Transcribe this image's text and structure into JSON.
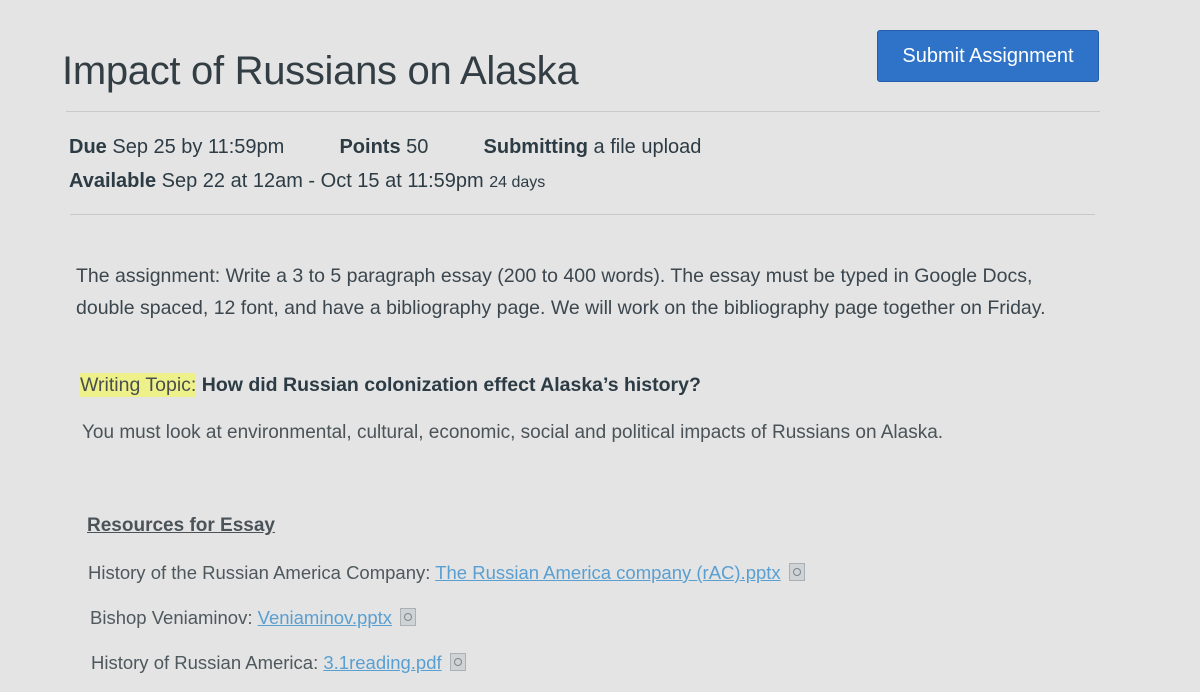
{
  "header": {
    "title": "Impact of Russians on Alaska",
    "submit_label": "Submit Assignment"
  },
  "details": {
    "due_label": "Due",
    "due_value": "Sep 25 by 11:59pm",
    "points_label": "Points",
    "points_value": "50",
    "submitting_label": "Submitting",
    "submitting_value": "a file upload",
    "available_label": "Available",
    "available_value": "Sep 22 at 12am - Oct 15 at 11:59pm",
    "available_days": "24 days"
  },
  "body": {
    "assignment_text": "The assignment: Write a 3 to 5 paragraph essay (200 to 400 words). The essay must be typed in Google Docs, double spaced, 12 font, and have a bibliography page. We will work on the bibliography page together on Friday.",
    "topic_label": "Writing Topic:",
    "topic_question": "How did Russian colonization effect Alaska’s history?",
    "instructions": "You must look at environmental, cultural, economic, social and political impacts of Russians on Alaska."
  },
  "resources": {
    "heading": "Resources for Essay",
    "items": [
      {
        "label": "History of the Russian America Company:",
        "link": "The Russian America company (rAC).pptx"
      },
      {
        "label": "Bishop Veniaminov:",
        "link": "Veniaminov.pptx"
      },
      {
        "label": "History of Russian America:",
        "link": "3.1reading.pdf"
      }
    ]
  },
  "colors": {
    "button": "#2f73c8",
    "link": "#5a9fd2",
    "highlight": "#eef08a",
    "background": "#e3e4e3"
  }
}
